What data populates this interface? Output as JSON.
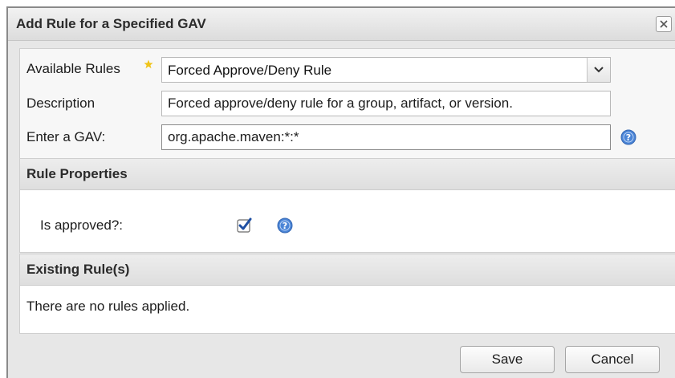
{
  "dialog": {
    "title": "Add Rule for a Specified GAV",
    "close_icon": "close-icon"
  },
  "form": {
    "available_rules": {
      "label": "Available Rules",
      "required_icon": "star-icon",
      "selected": "Forced Approve/Deny Rule",
      "dropdown_icon": "chevron-down-icon"
    },
    "description": {
      "label": "Description",
      "value": "Forced approve/deny rule for a group, artifact, or version."
    },
    "gav": {
      "label": "Enter a GAV:",
      "value": "org.apache.maven:*:*",
      "help_icon": "help-icon"
    }
  },
  "rule_properties": {
    "title": "Rule Properties",
    "is_approved": {
      "label": "Is approved?:",
      "checked": true,
      "help_icon": "help-icon"
    }
  },
  "existing_rules": {
    "title": "Existing Rule(s)",
    "empty_text": "There are no rules applied."
  },
  "buttons": {
    "save": "Save",
    "cancel": "Cancel"
  },
  "colors": {
    "help_icon": "#4a84d6",
    "checkbox_check": "#1f4fa3",
    "required_star": "#f0c419"
  }
}
